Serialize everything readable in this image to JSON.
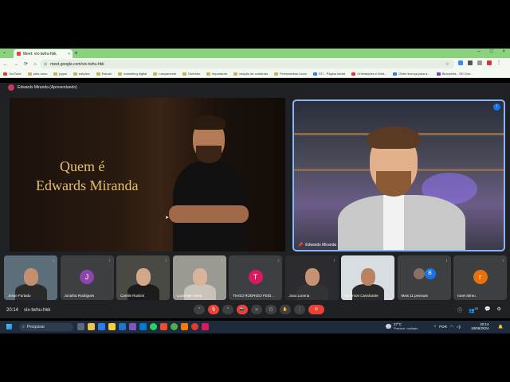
{
  "browser": {
    "tab_title": "Meet: vix-twhu-hkk",
    "tab_close": "×",
    "new_tab": "+",
    "tab_menu": "⌄",
    "window_controls": [
      "–",
      "□",
      "×"
    ],
    "nav": {
      "back": "←",
      "forward": "→",
      "reload": "⟳",
      "home": "⌂"
    },
    "url": "meet.google.com/vix-twhu-hkk",
    "lock_icon": "⊙",
    "star_icon": "☆",
    "menu_icon": "⋮",
    "bookmarks": [
      {
        "label": "YouTube",
        "icon": "red"
      },
      {
        "label": "pelo-novo",
        "icon": "folder"
      },
      {
        "label": "jogos",
        "icon": "folder"
      },
      {
        "label": "edições",
        "icon": "folder"
      },
      {
        "label": "Estudo",
        "icon": "folder"
      },
      {
        "label": "marketing digital",
        "icon": "folder"
      },
      {
        "label": "Lançamento",
        "icon": "folder"
      },
      {
        "label": "Dinheiro",
        "icon": "folder"
      },
      {
        "label": "importante",
        "icon": "folder"
      },
      {
        "label": "criação de conteúdo",
        "icon": "folder"
      },
      {
        "label": "Ferramentas Loom",
        "icon": "folder"
      },
      {
        "label": "STI - Página inicial",
        "icon": "blue"
      },
      {
        "label": "Orientações e Mód...",
        "icon": "red"
      },
      {
        "label": "Obter licença para a...",
        "icon": "blue"
      },
      {
        "label": "Blueprints - SD Gun...",
        "icon": "purple"
      }
    ]
  },
  "meet": {
    "presenting_label": "Edwards Miranda (Apresentando)",
    "presentation": {
      "line1": "Quem é",
      "line2": "Edwards Miranda"
    },
    "speaker_name": "Edwards Miranda",
    "participants": [
      {
        "name": "Jesse Furtado",
        "type": "video"
      },
      {
        "name": "Jonatha Rodrigues",
        "type": "avatar",
        "initial": "J",
        "color": "#8e44ad"
      },
      {
        "name": "Camile Rustick",
        "type": "video"
      },
      {
        "name": "Luzineide Vieira",
        "type": "video"
      },
      {
        "name": "TIAGO RODRIGO FEID...",
        "type": "avatar",
        "initial": "T",
        "color": "#d81b60"
      },
      {
        "name": "Joao Lucena",
        "type": "video"
      },
      {
        "name": "Emerson Cavalcante",
        "type": "video"
      },
      {
        "name": "Mais 11 pessoas",
        "type": "more"
      },
      {
        "name": "ronei abreu",
        "type": "avatar",
        "initial": "r",
        "color": "#e8710a"
      }
    ],
    "more_avatar_initials": [
      "",
      "B"
    ],
    "time": "20:14",
    "meeting_code": "vix-twhu-hkk",
    "controls": [
      "⌃",
      "🎙",
      "⌃",
      "📷",
      "☺",
      "▢",
      "✋",
      "⋮",
      "✆"
    ],
    "right_controls": [
      "ⓘ",
      "👥",
      "💬",
      "⚙"
    ],
    "right_badge": "20"
  },
  "taskbar": {
    "search_placeholder": "Pesquisar",
    "search_icon": "⌕",
    "weather_temp": "27°C",
    "weather_cond": "Predom. nublado",
    "tray": "POR",
    "clock_time": "20:14",
    "clock_date": "18/06/2024",
    "bell": "🔔"
  },
  "colors": {
    "tab_bar": "#8bd27d",
    "meet_bg": "#202124",
    "active_speaker_border": "#8ab4f8",
    "end_call": "#ea4335",
    "presentation_text": "#e6c06a"
  }
}
